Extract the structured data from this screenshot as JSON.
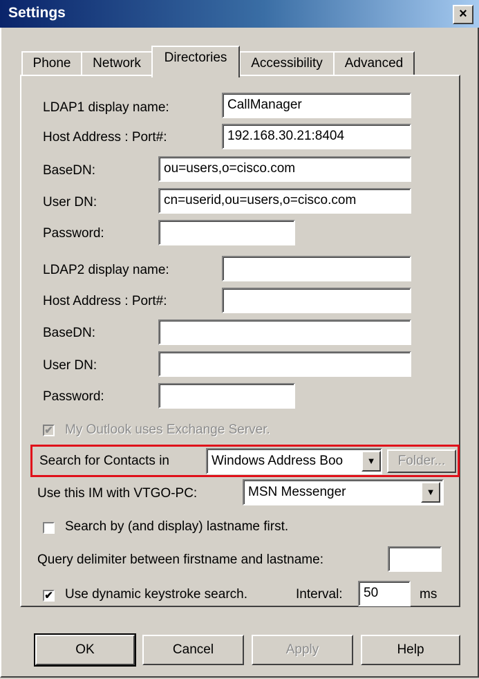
{
  "window": {
    "title": "Settings",
    "close_label": "×"
  },
  "tabs": [
    {
      "label": "Phone"
    },
    {
      "label": "Network"
    },
    {
      "label": "Directories"
    },
    {
      "label": "Accessibility"
    },
    {
      "label": "Advanced"
    }
  ],
  "ldap1": {
    "display_name_label": "LDAP1 display name:",
    "display_name_value": "CallManager",
    "host_label": "Host Address : Port#:",
    "host_value": "192.168.30.21:8404",
    "basedn_label": "BaseDN:",
    "basedn_value": "ou=users,o=cisco.com",
    "userdn_label": "User DN:",
    "userdn_value": "cn=userid,ou=users,o=cisco.com",
    "password_label": "Password:",
    "password_value": ""
  },
  "ldap2": {
    "display_name_label": "LDAP2 display name:",
    "display_name_value": "",
    "host_label": "Host Address : Port#:",
    "host_value": "",
    "basedn_label": "BaseDN:",
    "basedn_value": "",
    "userdn_label": "User DN:",
    "userdn_value": "",
    "password_label": "Password:",
    "password_value": ""
  },
  "outlook": {
    "label": "My Outlook uses Exchange Server.",
    "checked": true,
    "check_glyph": "✔"
  },
  "search_contacts": {
    "label": "Search for Contacts in",
    "selected": "Windows Address Boo",
    "folder_button": "Folder..."
  },
  "im": {
    "label": "Use this IM with VTGO-PC:",
    "selected": "MSN Messenger"
  },
  "lastname_first": {
    "label": "Search by (and display) lastname first.",
    "checked": false
  },
  "query_delimiter": {
    "label": "Query delimiter between firstname and lastname:",
    "value": ""
  },
  "dynamic_search": {
    "label": "Use dynamic keystroke search.",
    "checked": true,
    "check_glyph": "✔",
    "interval_label": "Interval:",
    "interval_value": "50",
    "unit": "ms"
  },
  "buttons": {
    "ok": "OK",
    "cancel": "Cancel",
    "apply": "Apply",
    "help": "Help"
  },
  "icons": {
    "dropdown": "▼"
  },
  "colors": {
    "highlight": "#e0101a",
    "titlebar": "#0a246a",
    "face": "#d4d0c8"
  }
}
